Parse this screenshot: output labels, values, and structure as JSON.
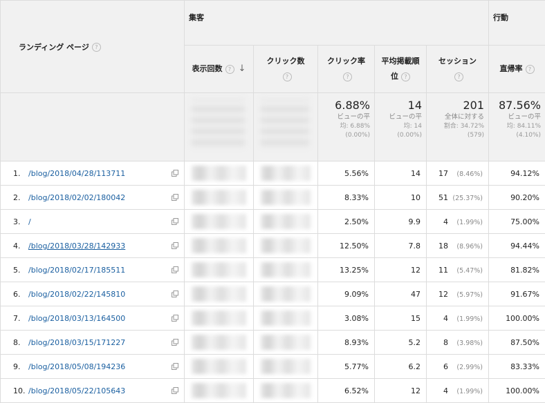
{
  "header": {
    "landing_page": "ランディング ページ",
    "group_acquisition": "集客",
    "group_behavior": "行動",
    "col_impressions": "表示回数",
    "col_clicks": "クリック数",
    "col_ctr": "クリック率",
    "col_avg_position_1": "平均掲載順",
    "col_avg_position_2": "位",
    "col_sessions": "セッション",
    "col_bounce": "直帰率",
    "help_glyph": "?",
    "sort_glyph": "↓"
  },
  "totals": {
    "ctr": {
      "value": "6.88%",
      "label": "ビューの平",
      "sub": "均: 6.88%",
      "sub2": "(0.00%)"
    },
    "avg_position": {
      "value": "14",
      "label": "ビューの平",
      "sub": "均: 14",
      "sub2": "(0.00%)"
    },
    "sessions": {
      "value": "201",
      "label": "全体に対する",
      "sub": "割合: 34.72%",
      "sub2": "(579)"
    },
    "bounce": {
      "value": "87.56%",
      "label": "ビューの平",
      "sub": "均: 84.11%",
      "sub2": "(4.10%)"
    }
  },
  "rows": [
    {
      "num": "1.",
      "page": "/blog/2018/04/28/113711",
      "ctr": "5.56%",
      "pos": "14",
      "sessions": "17",
      "sessions_pct": "(8.46%)",
      "bounce": "94.12%"
    },
    {
      "num": "2.",
      "page": "/blog/2018/02/02/180042",
      "ctr": "8.33%",
      "pos": "10",
      "sessions": "51",
      "sessions_pct": "(25.37%)",
      "bounce": "90.20%"
    },
    {
      "num": "3.",
      "page": "/",
      "ctr": "2.50%",
      "pos": "9.9",
      "sessions": "4",
      "sessions_pct": "(1.99%)",
      "bounce": "75.00%"
    },
    {
      "num": "4.",
      "page": "/blog/2018/03/28/142933",
      "ctr": "12.50%",
      "pos": "7.8",
      "sessions": "18",
      "sessions_pct": "(8.96%)",
      "bounce": "94.44%"
    },
    {
      "num": "5.",
      "page": "/blog/2018/02/17/185511",
      "ctr": "13.25%",
      "pos": "12",
      "sessions": "11",
      "sessions_pct": "(5.47%)",
      "bounce": "81.82%"
    },
    {
      "num": "6.",
      "page": "/blog/2018/02/22/145810",
      "ctr": "9.09%",
      "pos": "47",
      "sessions": "12",
      "sessions_pct": "(5.97%)",
      "bounce": "91.67%"
    },
    {
      "num": "7.",
      "page": "/blog/2018/03/13/164500",
      "ctr": "3.08%",
      "pos": "15",
      "sessions": "4",
      "sessions_pct": "(1.99%)",
      "bounce": "100.00%"
    },
    {
      "num": "8.",
      "page": "/blog/2018/03/15/171227",
      "ctr": "8.93%",
      "pos": "5.2",
      "sessions": "8",
      "sessions_pct": "(3.98%)",
      "bounce": "87.50%"
    },
    {
      "num": "9.",
      "page": "/blog/2018/05/08/194236",
      "ctr": "5.77%",
      "pos": "6.2",
      "sessions": "6",
      "sessions_pct": "(2.99%)",
      "bounce": "83.33%"
    },
    {
      "num": "10.",
      "page": "/blog/2018/05/22/105643",
      "ctr": "6.52%",
      "pos": "12",
      "sessions": "4",
      "sessions_pct": "(1.99%)",
      "bounce": "100.00%"
    }
  ],
  "icons": {
    "external": "open-in-new-window-icon",
    "help": "help-circle-icon",
    "sort": "sort-descending-icon"
  },
  "colors": {
    "link": "#1a5fa0",
    "header_bg": "#f1f1f1",
    "border": "#dcdcdc"
  }
}
